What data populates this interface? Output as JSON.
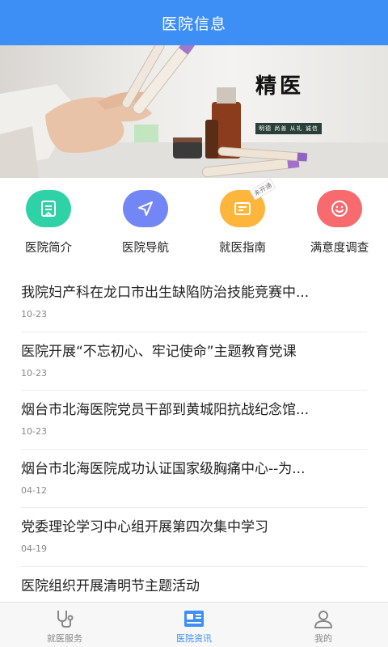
{
  "header": {
    "title": "医院信息"
  },
  "banner": {
    "calligraphy": "精医",
    "slogan": "明德 尚善 从礼 诚信"
  },
  "quick_menu": [
    {
      "label": "医院简介",
      "icon": "document-icon",
      "color": "#2fd1a7"
    },
    {
      "label": "医院导航",
      "icon": "navigation-arrow-icon",
      "color": "#7287f5"
    },
    {
      "label": "就医指南",
      "icon": "guide-icon",
      "color": "#fdb53c",
      "badge": "未开通"
    },
    {
      "label": "满意度调查",
      "icon": "smile-icon",
      "color": "#f76a6e"
    }
  ],
  "news": [
    {
      "title": "我院妇产科在龙口市出生缺陷防治技能竞赛中...",
      "date": "10-23"
    },
    {
      "title": "医院开展“不忘初心、牢记使命”主题教育党课",
      "date": "10-23"
    },
    {
      "title": "烟台市北海医院党员干部到黄城阳抗战纪念馆...",
      "date": "10-23"
    },
    {
      "title": "烟台市北海医院成功认证国家级胸痛中心--为...",
      "date": "04-12"
    },
    {
      "title": "党委理论学习中心组开展第四次集中学习",
      "date": "04-19"
    },
    {
      "title": "医院组织开展清明节主题活动",
      "date": ""
    }
  ],
  "tabbar": {
    "items": [
      {
        "label": "就医服务",
        "icon": "stethoscope-icon",
        "active": false
      },
      {
        "label": "医院资讯",
        "icon": "news-icon",
        "active": true
      },
      {
        "label": "我的",
        "icon": "user-icon",
        "active": false
      }
    ]
  },
  "colors": {
    "primary": "#3d8ef5",
    "inactive": "#888888"
  }
}
